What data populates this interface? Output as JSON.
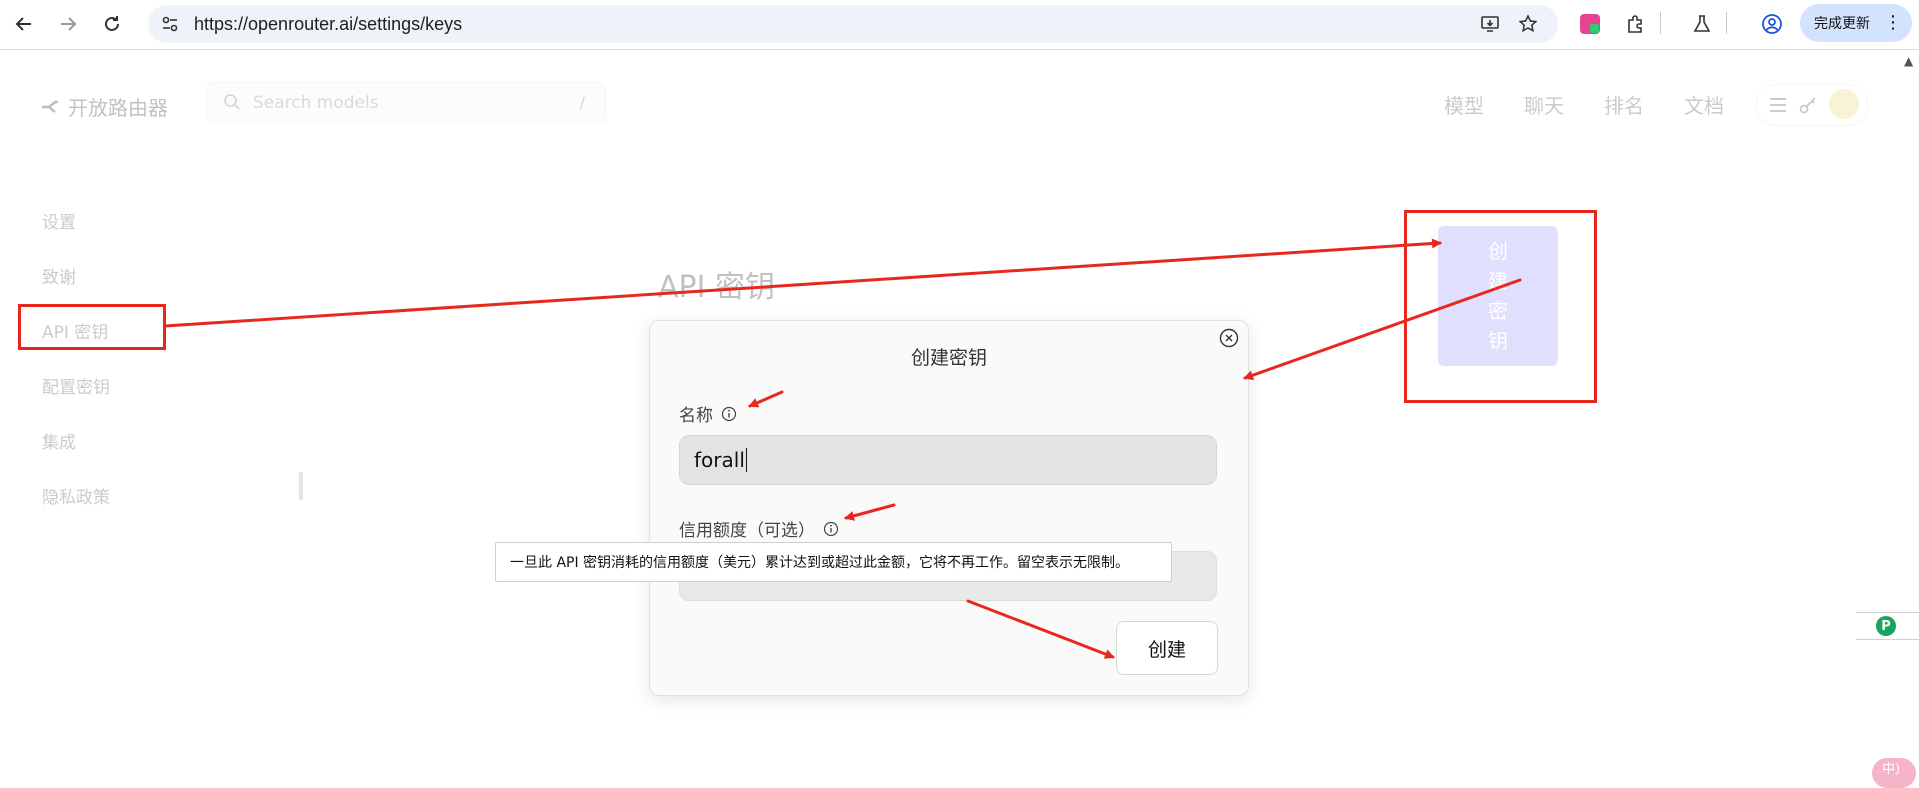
{
  "browser": {
    "url": "https://openrouter.ai/settings/keys",
    "update_label": "完成更新"
  },
  "site": {
    "logo_text": "开放路由器",
    "search_placeholder": "Search models",
    "search_shortcut": "/",
    "nav": [
      "模型",
      "聊天",
      "排名",
      "文档"
    ]
  },
  "sidebar": {
    "items": [
      {
        "label": "设置"
      },
      {
        "label": "致谢"
      },
      {
        "label": "API 密钥"
      },
      {
        "label": "配置密钥"
      },
      {
        "label": "集成"
      },
      {
        "label": "隐私政策"
      }
    ]
  },
  "main": {
    "title": "API 密钥",
    "create_key_chars": [
      "创",
      "建",
      "密",
      "钥"
    ]
  },
  "modal": {
    "title": "创建密钥",
    "name_label": "名称",
    "name_value": "forall",
    "credit_label": "信用额度（可选）",
    "credit_value": "",
    "submit_label": "创建",
    "tooltip": "一旦此 API 密钥消耗的信用额度（美元）累计达到或超过此金额，它将不再工作。留空表示无限制。"
  },
  "widgets": {
    "side_icon_letter": "P",
    "corner_badge_text": "中)"
  },
  "colors": {
    "annotation": "#e8281e",
    "create_button": "#a8a5fb",
    "update_pill": "#d3e3fd"
  }
}
